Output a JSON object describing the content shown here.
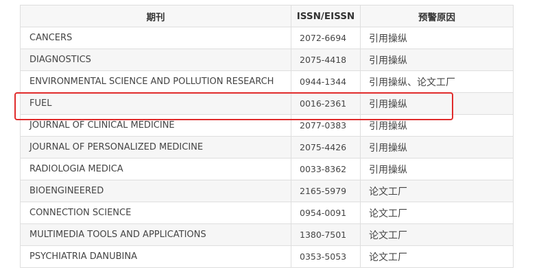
{
  "table": {
    "headers": [
      "期刊",
      "ISSN/EISSN",
      "预警原因"
    ],
    "rows": [
      {
        "journal": "CANCERS",
        "issn": "2072-6694",
        "reason": "引用操纵"
      },
      {
        "journal": "DIAGNOSTICS",
        "issn": "2075-4418",
        "reason": "引用操纵"
      },
      {
        "journal": "ENVIRONMENTAL SCIENCE AND POLLUTION RESEARCH",
        "issn": "0944-1344",
        "reason": "引用操纵、论文工厂"
      },
      {
        "journal": "FUEL",
        "issn": "0016-2361",
        "reason": "引用操纵"
      },
      {
        "journal": "JOURNAL OF CLINICAL MEDICINE",
        "issn": "2077-0383",
        "reason": "引用操纵"
      },
      {
        "journal": "JOURNAL OF PERSONALIZED MEDICINE",
        "issn": "2075-4426",
        "reason": "引用操纵"
      },
      {
        "journal": "RADIOLOGIA MEDICA",
        "issn": "0033-8362",
        "reason": "引用操纵"
      },
      {
        "journal": "BIOENGINEERED",
        "issn": "2165-5979",
        "reason": "论文工厂"
      },
      {
        "journal": "CONNECTION SCIENCE",
        "issn": "0954-0091",
        "reason": "论文工厂"
      },
      {
        "journal": "MULTIMEDIA TOOLS AND APPLICATIONS",
        "issn": "1380-7501",
        "reason": "论文工厂"
      },
      {
        "journal": "PSYCHIATRIA DANUBINA",
        "issn": "0353-5053",
        "reason": "论文工厂"
      }
    ]
  },
  "highlight": {
    "row_index": 3,
    "color": "#e02b2b"
  },
  "colors": {
    "header_bg": "#f7f7f7",
    "row_alt_bg": "#f6f6f6",
    "border": "#dedede",
    "text": "#444444"
  }
}
